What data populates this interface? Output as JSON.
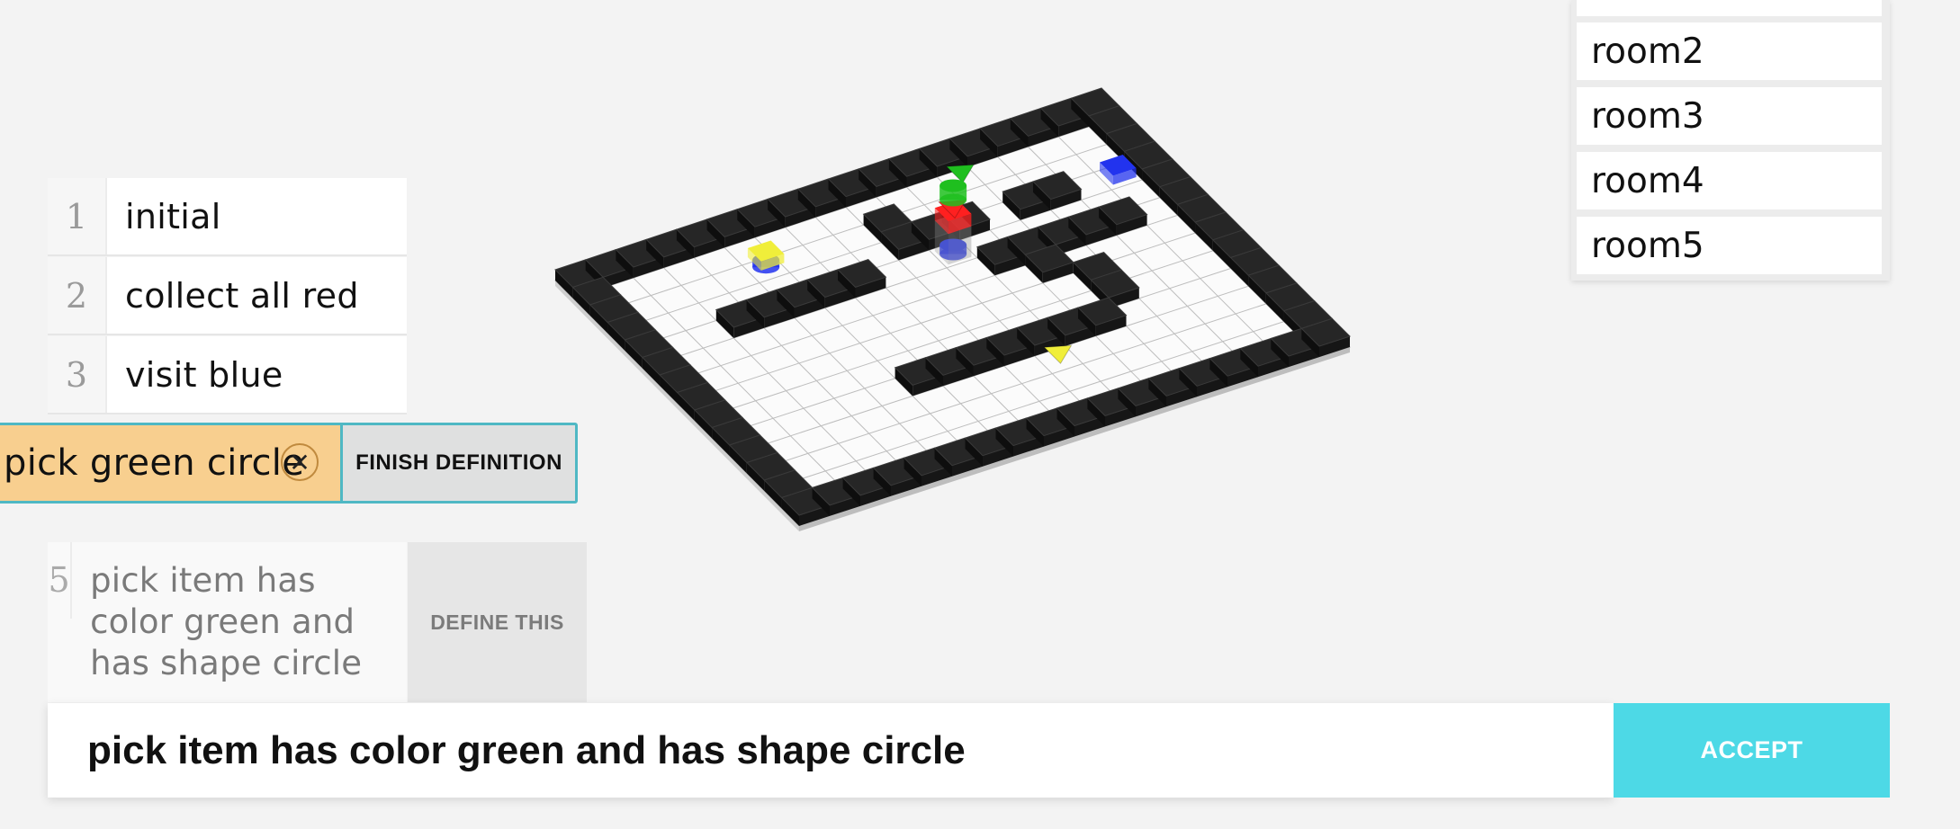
{
  "history": [
    {
      "num": "1",
      "text": "initial"
    },
    {
      "num": "2",
      "text": "collect all red"
    },
    {
      "num": "3",
      "text": "visit blue"
    }
  ],
  "editing": {
    "text": "pick green circle",
    "close_glyph": "✕",
    "finish_label": "FINISH DEFINITION"
  },
  "pending": {
    "num": "5",
    "text": "pick item has color green and has shape circle",
    "define_label": "DEFINE THIS"
  },
  "command": {
    "value": "pick item has color green and has shape circle",
    "accept_label": "ACCEPT"
  },
  "rooms": [
    "room2",
    "room3",
    "room4",
    "room5"
  ],
  "world": {
    "grid_cols": 18,
    "grid_rows": 14,
    "colors": {
      "floor": "#fbfbfb",
      "gridline": "#bdbdbd",
      "wall": "#262626",
      "green": "#1fbf1f",
      "red": "#ff2020",
      "blue": "#2233ee",
      "yellow": "#f0ee3a"
    }
  }
}
